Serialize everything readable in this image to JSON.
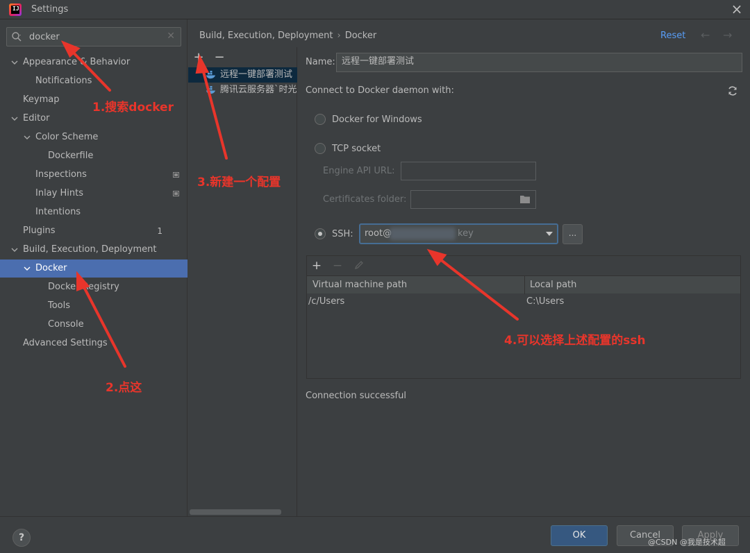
{
  "window": {
    "title": "Settings",
    "logo_text": "IJ"
  },
  "search": {
    "value": "docker"
  },
  "tree": [
    {
      "label": "Appearance & Behavior"
    },
    {
      "label": "Notifications"
    },
    {
      "label": "Keymap"
    },
    {
      "label": "Editor"
    },
    {
      "label": "Color Scheme"
    },
    {
      "label": "Dockerfile"
    },
    {
      "label": "Inspections"
    },
    {
      "label": "Inlay Hints"
    },
    {
      "label": "Intentions"
    },
    {
      "label": "Plugins",
      "badge": "1"
    },
    {
      "label": "Build, Execution, Deployment"
    },
    {
      "label": "Docker"
    },
    {
      "label": "Docker Registry"
    },
    {
      "label": "Tools"
    },
    {
      "label": "Console"
    },
    {
      "label": "Advanced Settings"
    }
  ],
  "breadcrumb": {
    "parent": "Build, Execution, Deployment",
    "sep": "›",
    "current": "Docker"
  },
  "header": {
    "reset": "Reset"
  },
  "configs": {
    "add": "+",
    "remove": "−",
    "items": [
      {
        "label": "远程一键部署测试"
      },
      {
        "label": "腾讯云服务器`时光论"
      }
    ]
  },
  "form": {
    "name_label": "Name:",
    "name_value": "远程一键部署测试",
    "connect_label": "Connect to Docker daemon with:",
    "docker_windows": "Docker for Windows",
    "tcp_socket": "TCP socket",
    "engine_api_label": "Engine API URL:",
    "engine_api_value": "",
    "cert_label": "Certificates folder:",
    "cert_value": "",
    "ssh_label": "SSH:",
    "ssh_value_prefix": "root@",
    "ssh_value_suffix": "key",
    "ellipsis": "...",
    "selected_option": "SSH"
  },
  "mappings": {
    "col_vm": "Virtual machine path",
    "col_local": "Local path",
    "rows": [
      {
        "vm": "/c/Users",
        "local": "C:\\Users"
      }
    ]
  },
  "status": "Connection successful",
  "footer": {
    "help": "?",
    "ok": "OK",
    "cancel": "Cancel",
    "apply": "Apply",
    "watermark": "@CSDN @我是技术超"
  },
  "annotations": {
    "step1": "1.搜索docker",
    "step2": "2.点这",
    "step3": "3.新建一个配置",
    "step4": "4.可以选择上述配置的ssh",
    "color": "#e8352b"
  },
  "colors": {
    "background": "#3c3f41",
    "selection": "#4b6eaf",
    "link": "#589df6",
    "ok_button": "#365880"
  }
}
